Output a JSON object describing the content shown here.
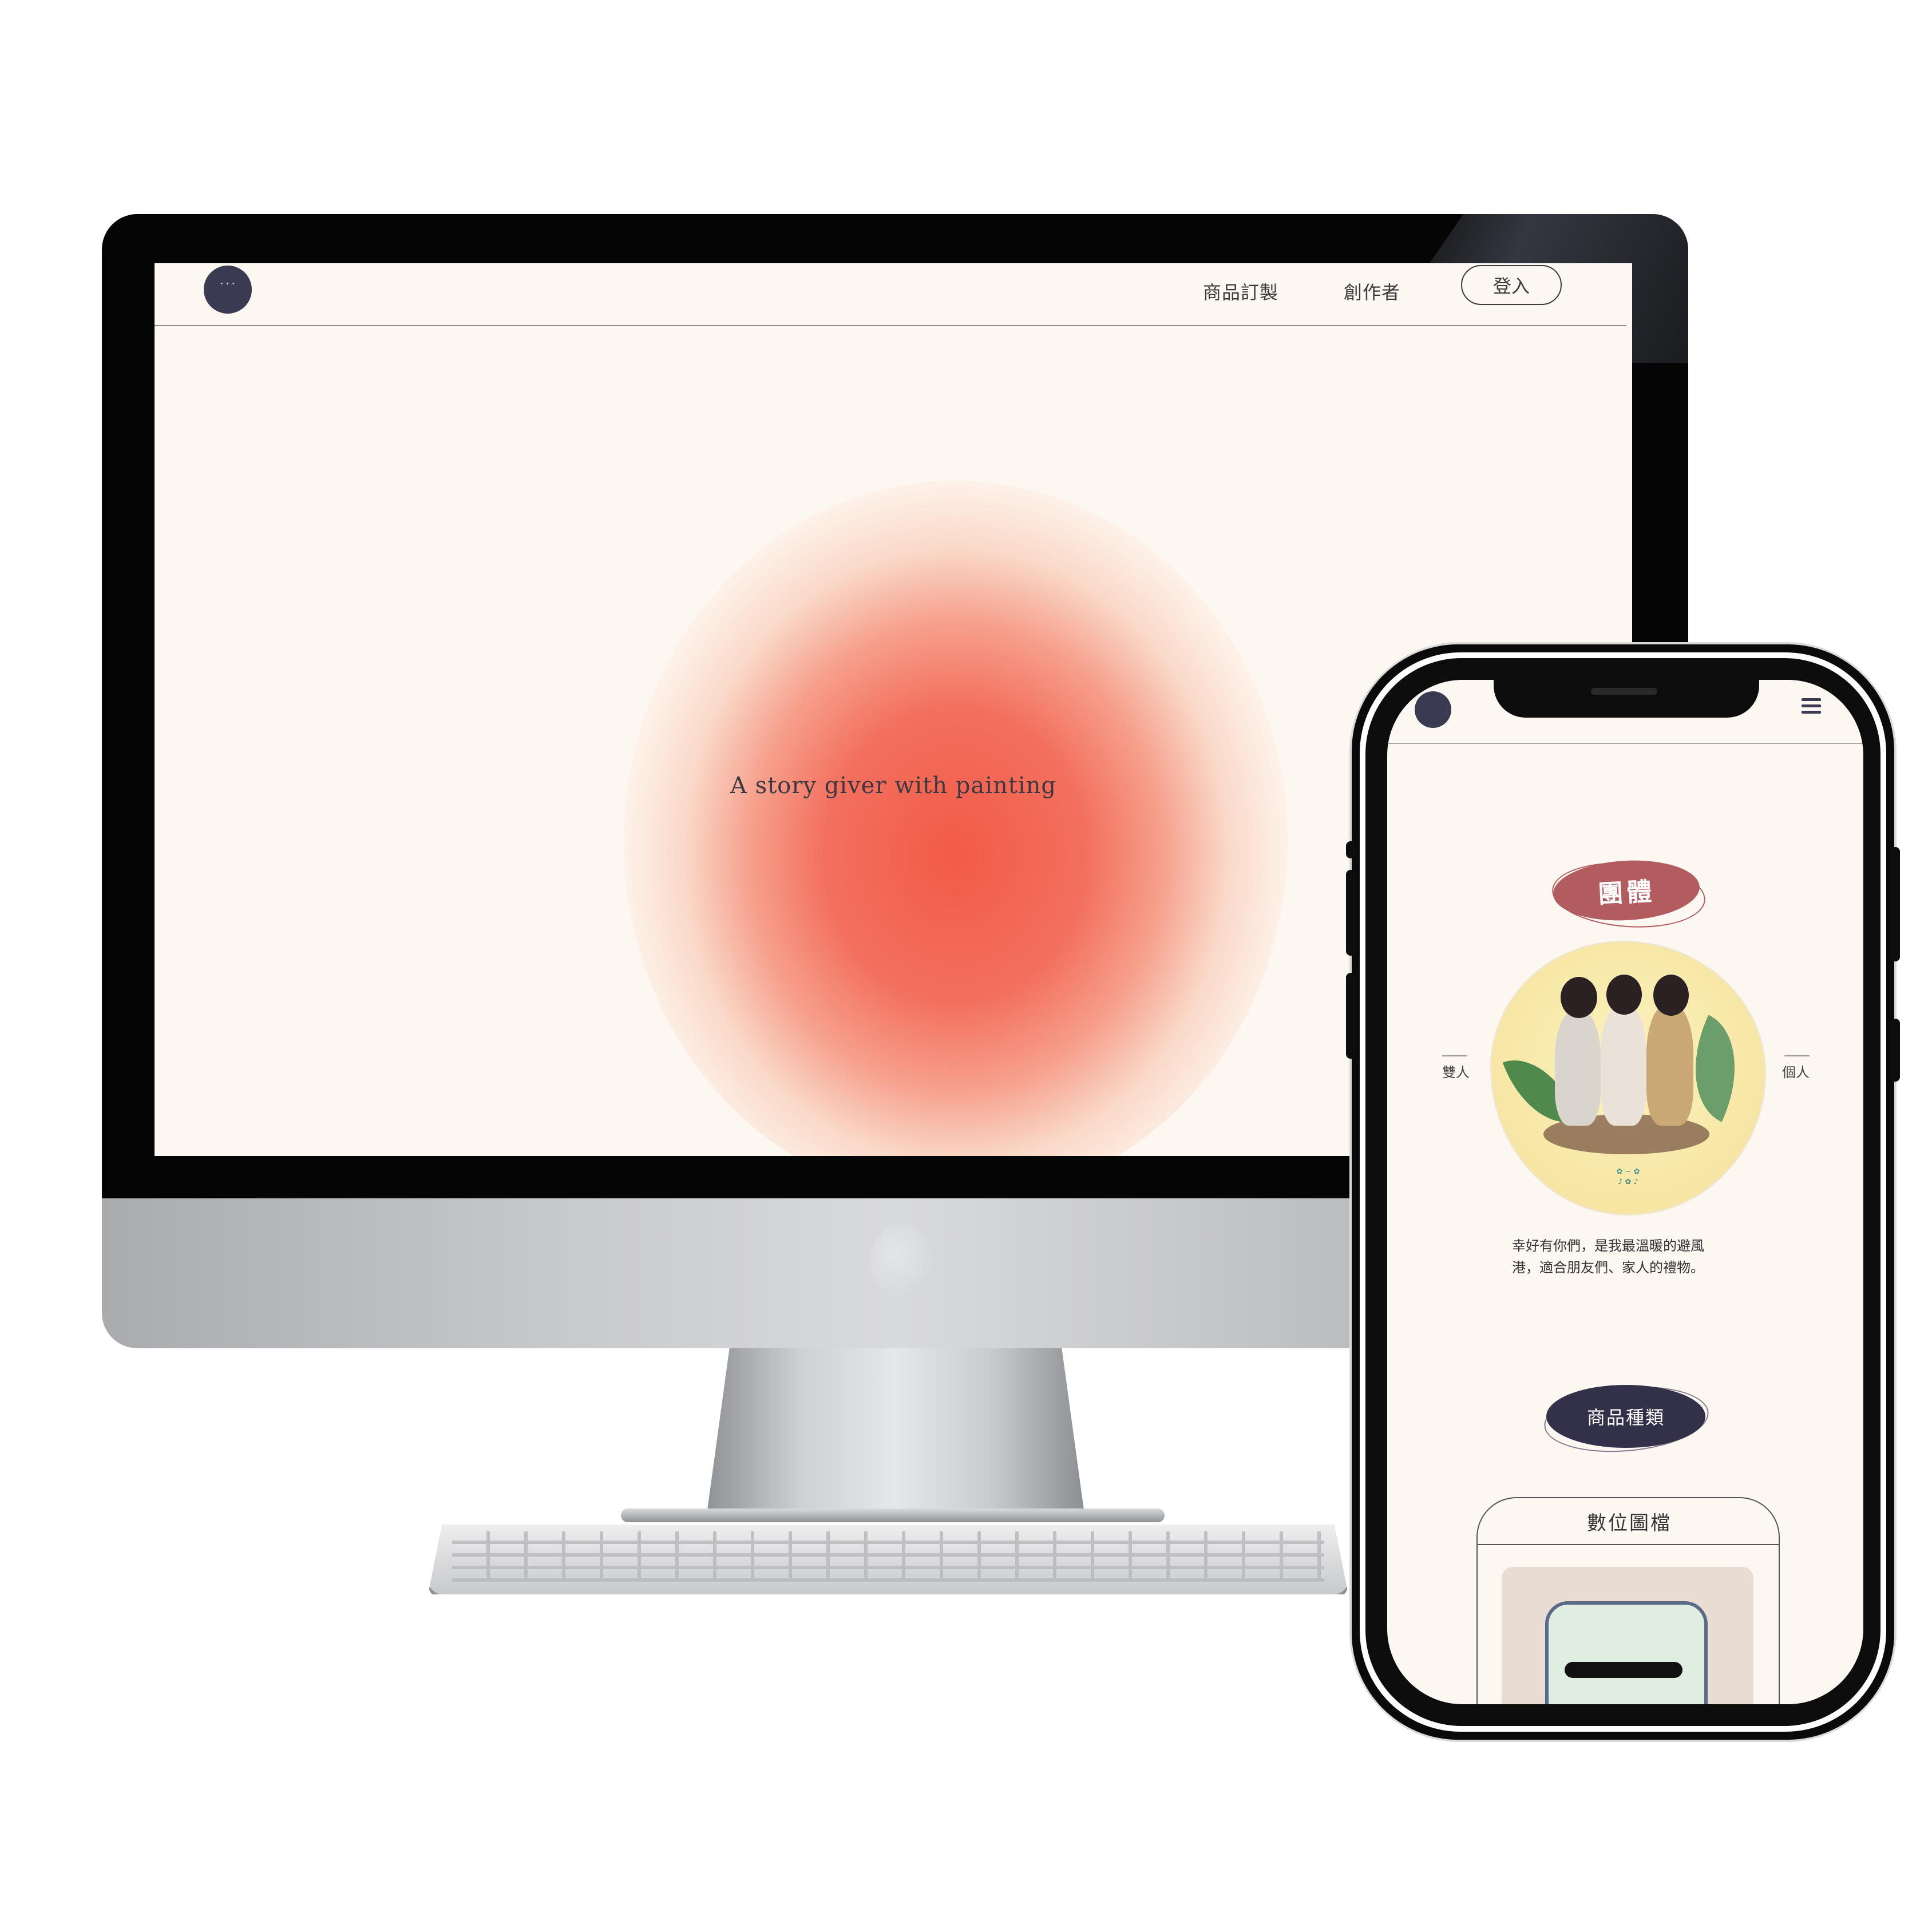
{
  "desktop": {
    "nav": {
      "items": [
        {
          "label": "商品訂製"
        },
        {
          "label": "創作者"
        }
      ],
      "login_label": "登入"
    },
    "hero": {
      "tagline": "A story giver with painting"
    },
    "colors": {
      "background": "#fdf7f1",
      "accent_blob": "#f25b47",
      "logo": "#3a3a52"
    }
  },
  "mobile": {
    "category_badge": "團體",
    "prev_label": "雙人",
    "next_label": "個人",
    "description_line1": "幸好有你們，是我最溫暖的避風",
    "description_line2": "港，適合朋友們、家人的禮物。",
    "product_types_label": "商品種類",
    "card_title": "數位圖檔",
    "colors": {
      "badge_group": "#b35c60",
      "badge_types": "#33304a"
    }
  }
}
